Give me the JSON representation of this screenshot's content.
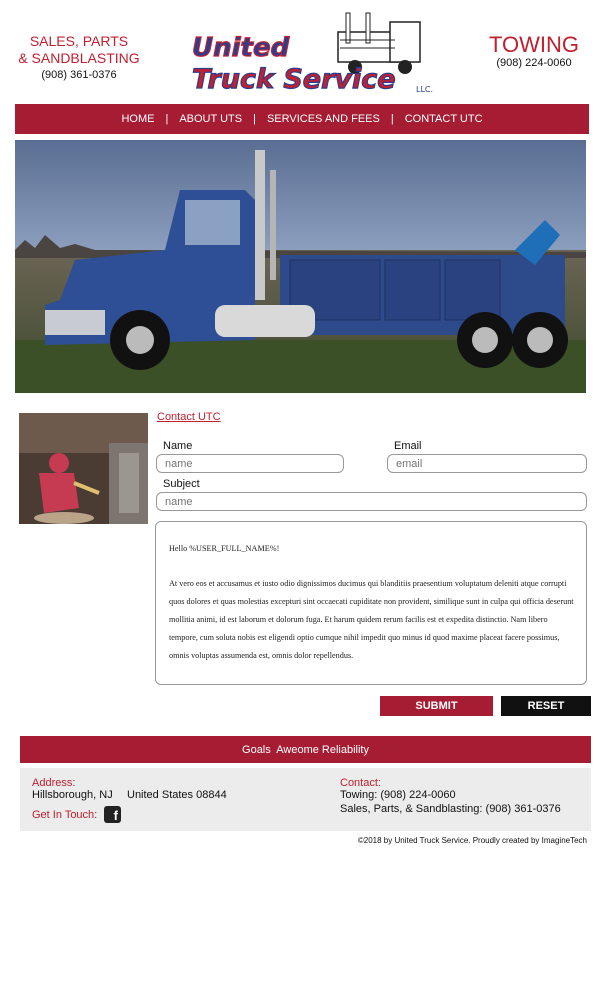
{
  "header": {
    "left_line1": "SALES, PARTS",
    "left_line2": "& SANDBLASTING",
    "left_phone": "(908) 361-0376",
    "right_title": "TOWING",
    "right_phone": "(908) 224-0060",
    "logo_word1": "United",
    "logo_word2": "Truck Service",
    "logo_suffix": "LLC."
  },
  "nav": {
    "items": [
      "HOME",
      "ABOUT UTS",
      "SERVICES AND FEES",
      "CONTACT UTC"
    ],
    "separator": "|"
  },
  "form": {
    "title": "Contact UTC",
    "name_label": "Name",
    "name_placeholder": "name",
    "email_label": "Email",
    "email_placeholder": "email",
    "subject_label": "Subject",
    "subject_placeholder": "name",
    "message_greeting": "Hello %USER_FULL_NAME%!",
    "message_body": "At vero eos et accusamus et iusto odio dignissimos ducimus qui blanditiis praesentium voluptatum deleniti atque corrupti quos dolores et quas molestias excepturi sint occaecati cupiditate non provident, similique sunt in culpa qui officia deserunt mollitia animi, id est laborum et dolorum fuga. Et harum quidem rerum facilis est et expedita distinctio. Nam libero tempore, cum soluta nobis est eligendi optio cumque nihil impedit quo minus id quod maxime placeat facere possimus, omnis voluptas assumenda est, omnis dolor repellendus.",
    "submit_label": "SUBMIT",
    "reset_label": "RESET"
  },
  "banner": {
    "text": "Goals  Aweome Reliability"
  },
  "footer": {
    "address_label": "Address:",
    "address_city": "Hillsborough, NJ",
    "address_country": "United States 08844",
    "touch_label": "Get In Touch:",
    "contact_label": "Contact:",
    "towing_line": "Towing: (908) 224-0060",
    "sales_line": "Sales, Parts, & Sandblasting: (908) 361-0376",
    "copyright": "©2018 by United Truck Service. Proudly created by ImagineTech"
  },
  "colors": {
    "brand_red": "#a61d33",
    "accent_red": "#c0202f",
    "info_bg": "#ececec"
  },
  "icons": {
    "social": "facebook-icon"
  }
}
